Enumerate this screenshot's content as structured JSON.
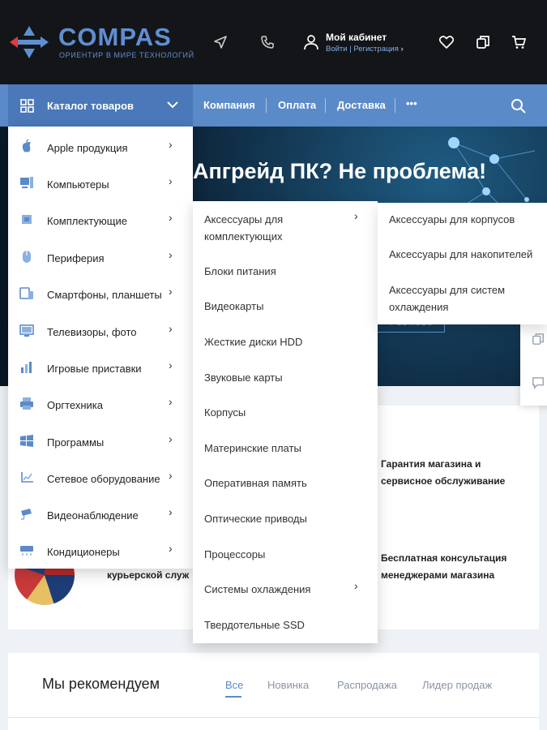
{
  "header": {
    "logo_name": "COMPAS",
    "logo_tagline": "ОРИЕНТИР В МИРЕ ТЕХНОЛОГИЙ",
    "cabinet_title": "Мой кабинет",
    "cabinet_links": "Войти | Регистрация",
    "icons": [
      "location-arrow-icon",
      "phone-icon",
      "user-icon",
      "heart-icon",
      "compare-icon",
      "cart-icon"
    ]
  },
  "nav": {
    "catalog_label": "Каталог товаров",
    "links": [
      "Компания",
      "Оплата",
      "Доставка"
    ],
    "more": "•••"
  },
  "catalog_menu": [
    {
      "label": "Apple продукция",
      "icon": "apple-icon"
    },
    {
      "label": "Компьютеры",
      "icon": "computer-icon"
    },
    {
      "label": "Комплектующие",
      "icon": "components-icon"
    },
    {
      "label": "Периферия",
      "icon": "mouse-icon"
    },
    {
      "label": "Смартфоны, планшеты",
      "icon": "smartphone-icon"
    },
    {
      "label": "Телевизоры, фото",
      "icon": "tv-icon"
    },
    {
      "label": "Игровые приставки",
      "icon": "gamepad-icon"
    },
    {
      "label": "Оргтехника",
      "icon": "printer-icon"
    },
    {
      "label": "Программы",
      "icon": "windows-icon"
    },
    {
      "label": "Сетевое оборудование",
      "icon": "network-icon"
    },
    {
      "label": "Видеонаблюдение",
      "icon": "camera-icon"
    },
    {
      "label": "Кондиционеры",
      "icon": "air-conditioner-icon"
    }
  ],
  "submenu": [
    {
      "label": "Аксессуары для комплектующих",
      "has_children": true
    },
    {
      "label": "Блоки питания",
      "has_children": false
    },
    {
      "label": "Видеокарты",
      "has_children": false
    },
    {
      "label": "Жесткие диски HDD",
      "has_children": false
    },
    {
      "label": "Звуковые карты",
      "has_children": false
    },
    {
      "label": "Корпусы",
      "has_children": false
    },
    {
      "label": "Материнские платы",
      "has_children": false
    },
    {
      "label": "Оперативная память",
      "has_children": false
    },
    {
      "label": "Оптические приводы",
      "has_children": false
    },
    {
      "label": "Процессоры",
      "has_children": false
    },
    {
      "label": "Системы охлаждения",
      "has_children": true
    },
    {
      "label": "Твердотельные SSD",
      "has_children": false
    }
  ],
  "submenu2": [
    "Аксессуары для корпусов",
    "Аксессуары для накопителей",
    "Аксессуары для систем охлаждения"
  ],
  "banner": {
    "title": "Апгрейд ПК? Не проблема!",
    "button": "# GDMODS"
  },
  "features": {
    "warranty": "Гарантия магазина и сервисное обслуживание",
    "consult": "Бесплатная консультация менеджерами магазина",
    "courier": "курьерской служ"
  },
  "recommend": {
    "title": "Мы рекомендуем",
    "tabs": [
      "Все",
      "Новинка",
      "Распродажа",
      "Лидер продаж"
    ],
    "active_tab": "Все"
  },
  "colors": {
    "accent": "#5b8ac9",
    "header_bg": "#141519",
    "catalog_bg": "#4a78b8"
  }
}
